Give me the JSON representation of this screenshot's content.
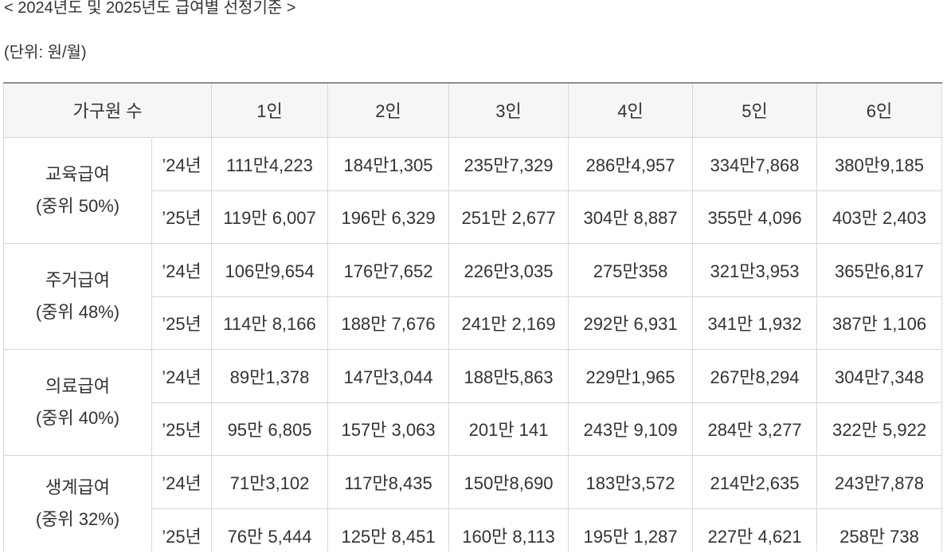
{
  "caption": "< 2024년도 및 2025년도 급여별 선정기준 >",
  "unit_note": "(단위: 원/월)",
  "theme": {
    "text": "#333333",
    "background": "#ffffff",
    "header_background": "#f6f6f6",
    "border": "#d7d7d7",
    "top_rule": "#8f8f8f"
  },
  "table": {
    "header": {
      "household_label": "가구원 수",
      "columns": [
        "1인",
        "2인",
        "3인",
        "4인",
        "5인",
        "6인"
      ]
    },
    "groups": [
      {
        "name": "교육급여",
        "criterion": "(중위 50%)",
        "rows": [
          {
            "year": "’24년",
            "values": [
              "111만4,223",
              "184만1,305",
              "235만7,329",
              "286만4,957",
              "334만7,868",
              "380만9,185"
            ]
          },
          {
            "year": "’25년",
            "values": [
              "119만 6,007",
              "196만 6,329",
              "251만 2,677",
              "304만 8,887",
              "355만 4,096",
              "403만 2,403"
            ]
          }
        ]
      },
      {
        "name": "주거급여",
        "criterion": "(중위 48%)",
        "rows": [
          {
            "year": "’24년",
            "values": [
              "106만9,654",
              "176만7,652",
              "226만3,035",
              "275만358",
              "321만3,953",
              "365만6,817"
            ]
          },
          {
            "year": "’25년",
            "values": [
              "114만 8,166",
              "188만 7,676",
              "241만 2,169",
              "292만 6,931",
              "341만 1,932",
              "387만 1,106"
            ]
          }
        ]
      },
      {
        "name": "의료급여",
        "criterion": "(중위 40%)",
        "rows": [
          {
            "year": "’24년",
            "values": [
              "89만1,378",
              "147만3,044",
              "188만5,863",
              "229만1,965",
              "267만8,294",
              "304만7,348"
            ]
          },
          {
            "year": "’25년",
            "values": [
              "95만 6,805",
              "157만 3,063",
              "201만 141",
              "243만 9,109",
              "284만 3,277",
              "322만 5,922"
            ]
          }
        ]
      },
      {
        "name": "생계급여",
        "criterion": "(중위 32%)",
        "rows": [
          {
            "year": "’24년",
            "values": [
              "71만3,102",
              "117만8,435",
              "150만8,690",
              "183만3,572",
              "214만2,635",
              "243만7,878"
            ]
          },
          {
            "year": "’25년",
            "values": [
              "76만 5,444",
              "125만 8,451",
              "160만 8,113",
              "195만 1,287",
              "227만 4,621",
              "258만 738"
            ]
          }
        ]
      }
    ]
  }
}
